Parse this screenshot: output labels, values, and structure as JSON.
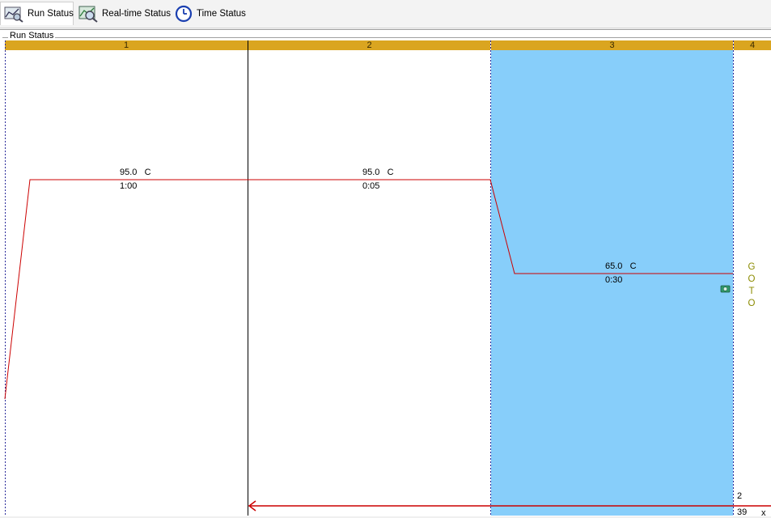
{
  "tabs": [
    {
      "label": "Run Status",
      "icon": "run-status-icon",
      "active": true
    },
    {
      "label": "Real-time Status",
      "icon": "realtime-status-icon",
      "active": false
    },
    {
      "label": "Time Status",
      "icon": "clock-icon",
      "active": false
    }
  ],
  "panel": {
    "title": "Run Status"
  },
  "steps": [
    {
      "number": "1",
      "temp": "95.0",
      "unit": "C",
      "time": "1:00"
    },
    {
      "number": "2",
      "temp": "95.0",
      "unit": "C",
      "time": "0:05"
    },
    {
      "number": "3",
      "temp": "65.0",
      "unit": "C",
      "time": "0:30"
    },
    {
      "number": "4"
    }
  ],
  "goto": {
    "letters": [
      "G",
      "O",
      "T",
      "O"
    ],
    "target_step": "2",
    "cycles": "39",
    "times_symbol": "x"
  },
  "colors": {
    "header": "#daa520",
    "active_step": "#87cefa",
    "temperature_line": "#cc0000"
  }
}
